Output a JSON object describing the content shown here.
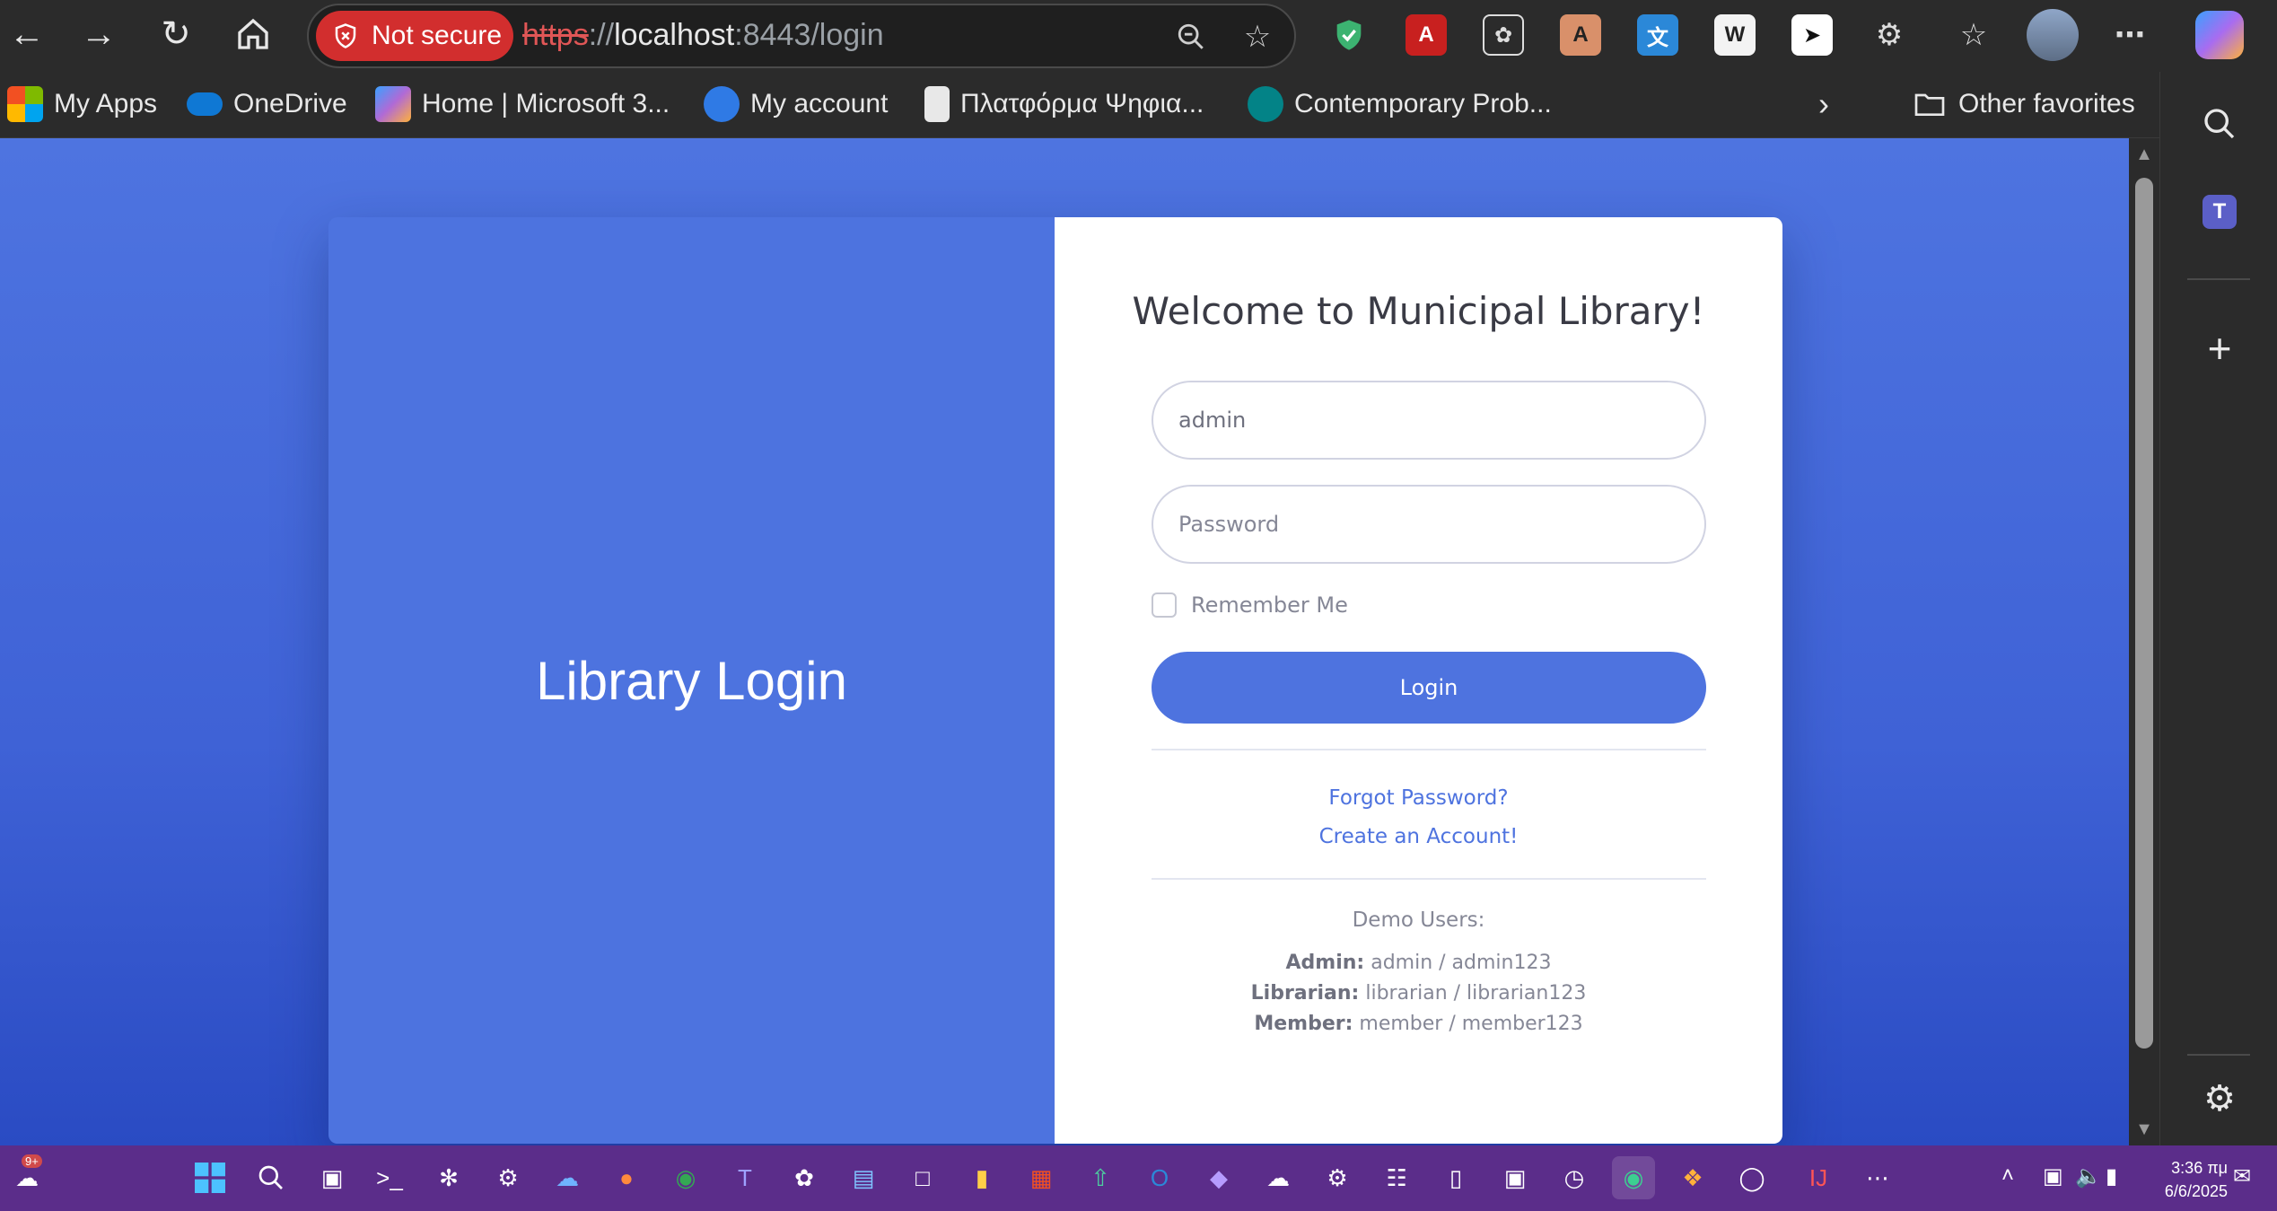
{
  "browser": {
    "security_label": "Not secure",
    "url_scheme": "https",
    "url_sep": "://",
    "url_host": "localhost",
    "url_port": ":8443",
    "url_path": "/login"
  },
  "favorites": [
    {
      "label": "My Apps",
      "icon": "microsoft-apps-icon",
      "color": "#f25022"
    },
    {
      "label": "OneDrive",
      "icon": "onedrive-icon",
      "color": "#0f78d4"
    },
    {
      "label": "Home | Microsoft 3...",
      "icon": "microsoft365-icon",
      "color": "#b06ad6"
    },
    {
      "label": "My account",
      "icon": "account-icon",
      "color": "#2f7ae5"
    },
    {
      "label": "Πλατφόρμα Ψηφια...",
      "icon": "platform-icon",
      "color": "#ffffff"
    },
    {
      "label": "Contemporary Prob...",
      "icon": "sharepoint-icon",
      "color": "#038387"
    }
  ],
  "other_favorites": "Other favorites",
  "login": {
    "side_title": "Library Login",
    "heading": "Welcome to Municipal Library!",
    "username_value": "admin",
    "password_placeholder": "Password",
    "remember_label": "Remember Me",
    "button_label": "Login",
    "forgot_link": "Forgot Password?",
    "create_link": "Create an Account!",
    "demo_heading": "Demo Users:",
    "demo_users": [
      {
        "role": "Admin:",
        "creds": "admin / admin123"
      },
      {
        "role": "Librarian:",
        "creds": "librarian / librarian123"
      },
      {
        "role": "Member:",
        "creds": "member / member123"
      }
    ]
  },
  "taskbar": {
    "weather_badge": "9+",
    "time": "3:36 πμ",
    "date": "6/6/2025"
  },
  "colors": {
    "primary": "#4e73df",
    "page_bg": "#3f62d6",
    "not_secure": "#d22e2e",
    "taskbar": "#5b2d8a"
  }
}
